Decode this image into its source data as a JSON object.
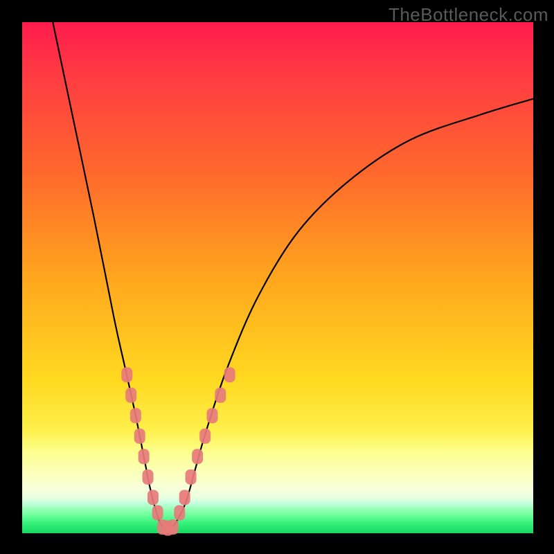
{
  "watermark": "TheBottleneck.com",
  "chart_data": {
    "type": "line",
    "title": "",
    "xlabel": "",
    "ylabel": "",
    "xlim": [
      0,
      100
    ],
    "ylim": [
      0,
      100
    ],
    "legend": false,
    "grid": false,
    "series": [
      {
        "name": "bottleneck-curve",
        "color": "#000000",
        "x": [
          6,
          10,
          14,
          18,
          20,
          22,
          24,
          25,
          26,
          27,
          28,
          29,
          30,
          32,
          34,
          36,
          40,
          46,
          54,
          64,
          76,
          90,
          100
        ],
        "values": [
          100,
          81,
          62,
          42,
          33,
          24,
          14,
          9,
          5,
          2,
          1,
          1,
          2,
          6,
          13,
          20,
          32,
          46,
          59,
          69,
          77,
          82,
          85
        ]
      }
    ],
    "markers": [
      {
        "name": "left-cluster",
        "shape": "rounded-rect",
        "color": "#e77b7b",
        "points": [
          {
            "x": 20.5,
            "y": 31
          },
          {
            "x": 21.3,
            "y": 27
          },
          {
            "x": 22.2,
            "y": 23
          },
          {
            "x": 23.0,
            "y": 19
          },
          {
            "x": 23.8,
            "y": 15
          },
          {
            "x": 24.6,
            "y": 11
          },
          {
            "x": 25.6,
            "y": 7
          },
          {
            "x": 26.5,
            "y": 4
          }
        ]
      },
      {
        "name": "bottom-cluster",
        "shape": "rounded-rect",
        "color": "#e77b7b",
        "points": [
          {
            "x": 27.5,
            "y": 1.2
          },
          {
            "x": 28.5,
            "y": 1.0
          },
          {
            "x": 29.5,
            "y": 1.2
          }
        ]
      },
      {
        "name": "right-cluster",
        "shape": "rounded-rect",
        "color": "#e77b7b",
        "points": [
          {
            "x": 30.8,
            "y": 4
          },
          {
            "x": 31.8,
            "y": 7
          },
          {
            "x": 33.0,
            "y": 11
          },
          {
            "x": 34.3,
            "y": 15
          },
          {
            "x": 35.8,
            "y": 19
          },
          {
            "x": 37.2,
            "y": 23
          },
          {
            "x": 38.8,
            "y": 27
          },
          {
            "x": 40.6,
            "y": 31
          }
        ]
      }
    ]
  }
}
